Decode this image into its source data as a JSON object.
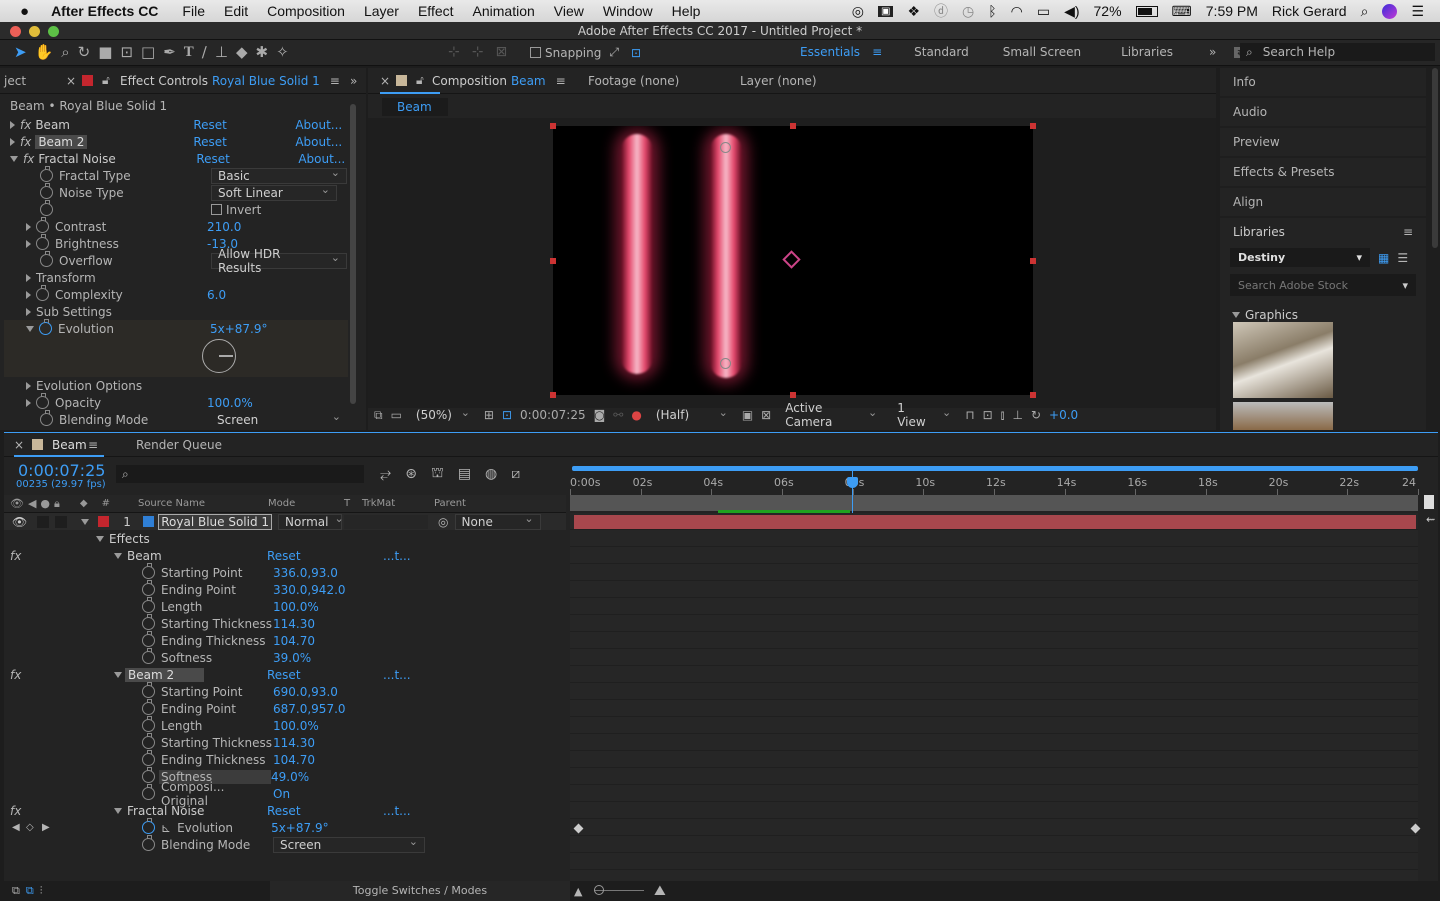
{
  "menubar": {
    "app": "After Effects CC",
    "items": [
      "File",
      "Edit",
      "Composition",
      "Layer",
      "Effect",
      "Animation",
      "View",
      "Window",
      "Help"
    ],
    "battery": "72%",
    "time": "7:59 PM",
    "user": "Rick Gerard"
  },
  "window": {
    "title": "Adobe After Effects CC 2017 - Untitled Project *"
  },
  "toolbar": {
    "snapping": "Snapping",
    "workspaces": [
      "Essentials",
      "Standard",
      "Small Screen",
      "Libraries"
    ],
    "search_placeholder": "Search Help"
  },
  "project_tab": "ject",
  "effect_controls": {
    "tab_prefix": "Effect Controls",
    "tab_layer": "Royal Blue Solid 1",
    "breadcrumb": "Beam • Royal Blue Solid 1",
    "reset": "Reset",
    "about": "About...",
    "fx": [
      {
        "name": "Beam",
        "selected": false
      },
      {
        "name": "Beam 2",
        "selected": true
      },
      {
        "name": "Fractal Noise",
        "selected": false
      }
    ],
    "props": {
      "fractal_type": "Fractal Type",
      "fractal_type_val": "Basic",
      "noise_type": "Noise Type",
      "noise_type_val": "Soft Linear",
      "invert": "Invert",
      "contrast": "Contrast",
      "contrast_val": "210.0",
      "brightness": "Brightness",
      "brightness_val": "-13.0",
      "overflow": "Overflow",
      "overflow_val": "Allow HDR Results",
      "transform": "Transform",
      "complexity": "Complexity",
      "complexity_val": "6.0",
      "sub_settings": "Sub Settings",
      "evolution": "Evolution",
      "evolution_val": "5x+87.9°",
      "evolution_options": "Evolution Options",
      "opacity": "Opacity",
      "opacity_val": "100.0%",
      "blending": "Blending Mode",
      "blending_val": "Screen"
    }
  },
  "comp": {
    "tab_prefix": "Composition",
    "tab_name": "Beam",
    "footage": "Footage (none)",
    "layer": "Layer (none)",
    "subtab": "Beam",
    "zoom": "(50%)",
    "timecode": "0:00:07:25",
    "resolution": "(Half)",
    "camera": "Active Camera",
    "views": "1 View",
    "exposure": "+0.0"
  },
  "right_panels": {
    "items": [
      "Info",
      "Audio",
      "Preview",
      "Effects & Presets",
      "Align",
      "Libraries"
    ],
    "library": "Destiny",
    "stock_placeholder": "Search Adobe Stock",
    "graphics": "Graphics"
  },
  "timeline": {
    "tab": "Beam",
    "render_queue": "Render Queue",
    "timecode": "0:00:07:25",
    "frames": "00235 (29.97 fps)",
    "cols": {
      "num": "#",
      "source": "Source Name",
      "mode": "Mode",
      "t": "T",
      "trkmat": "TrkMat",
      "parent": "Parent"
    },
    "ruler": [
      "0:00s",
      "02s",
      "04s",
      "06s",
      "08s",
      "10s",
      "12s",
      "14s",
      "16s",
      "18s",
      "20s",
      "22s",
      "24"
    ],
    "current_time_fraction": 0.332,
    "layer": {
      "num": "1",
      "name": "Royal Blue Solid 1",
      "mode": "Normal",
      "parent": "None"
    },
    "effects_label": "Effects",
    "reset": "Reset",
    "dots": "...t...",
    "beam": {
      "name": "Beam",
      "props": [
        [
          "Starting Point",
          "336.0,93.0"
        ],
        [
          "Ending Point",
          "330.0,942.0"
        ],
        [
          "Length",
          "100.0%"
        ],
        [
          "Starting Thickness",
          "114.30"
        ],
        [
          "Ending Thickness",
          "104.70"
        ],
        [
          "Softness",
          "39.0%"
        ]
      ]
    },
    "beam2": {
      "name": "Beam 2",
      "props": [
        [
          "Starting Point",
          "690.0,93.0"
        ],
        [
          "Ending Point",
          "687.0,957.0"
        ],
        [
          "Length",
          "100.0%"
        ],
        [
          "Starting Thickness",
          "114.30"
        ],
        [
          "Ending Thickness",
          "104.70"
        ],
        [
          "Softness",
          "49.0%"
        ],
        [
          "Composi... Original",
          "On"
        ]
      ]
    },
    "fractal": {
      "name": "Fractal Noise",
      "evolution": "Evolution",
      "evolution_val": "5x+87.9°",
      "blending": "Blending Mode",
      "blending_val": "Screen"
    },
    "toggle": "Toggle Switches / Modes"
  },
  "colors": {
    "accent": "#3d9df5",
    "layer_bar": "#a8474d",
    "label_red": "#c4262e",
    "label_blue": "#2f7fd6"
  }
}
